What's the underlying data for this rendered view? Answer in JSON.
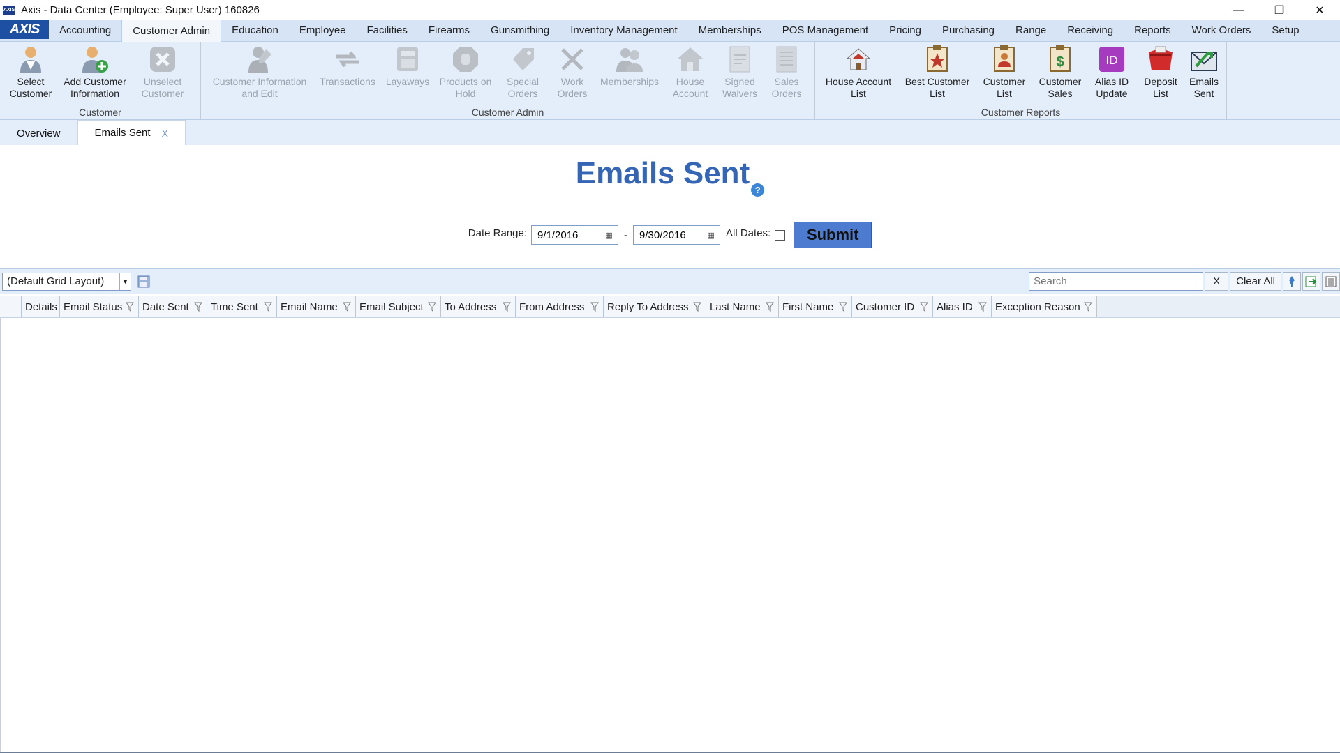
{
  "window": {
    "title": "Axis - Data Center  (Employee: Super User) 160826",
    "icon_text": "AXIS"
  },
  "menubar": {
    "logo": "AXIS",
    "tabs": [
      "Accounting",
      "Customer Admin",
      "Education",
      "Employee",
      "Facilities",
      "Firearms",
      "Gunsmithing",
      "Inventory Management",
      "Memberships",
      "POS Management",
      "Pricing",
      "Purchasing",
      "Range",
      "Receiving",
      "Reports",
      "Work Orders",
      "Setup"
    ],
    "active": "Customer Admin"
  },
  "ribbon": {
    "groups": [
      {
        "label": "Customer",
        "buttons": [
          {
            "line1": "Select",
            "line2": "Customer",
            "icon": "person-icon"
          },
          {
            "line1": "Add Customer",
            "line2": "Information",
            "icon": "add-person-icon"
          },
          {
            "line1": "Unselect",
            "line2": "Customer",
            "icon": "unselect-icon",
            "disabled": true
          }
        ]
      },
      {
        "label": "Customer Admin",
        "buttons": [
          {
            "line1": "Customer Information",
            "line2": "and Edit",
            "icon": "customer-edit-icon",
            "disabled": true
          },
          {
            "line1": "Transactions",
            "line2": "",
            "icon": "transactions-icon",
            "disabled": true
          },
          {
            "line1": "Layaways",
            "line2": "",
            "icon": "layaway-icon",
            "disabled": true
          },
          {
            "line1": "Products on",
            "line2": "Hold",
            "icon": "hold-icon",
            "disabled": true
          },
          {
            "line1": "Special",
            "line2": "Orders",
            "icon": "special-tag-icon",
            "disabled": true
          },
          {
            "line1": "Work",
            "line2": "Orders",
            "icon": "tools-icon",
            "disabled": true
          },
          {
            "line1": "Memberships",
            "line2": "",
            "icon": "members-icon",
            "disabled": true
          },
          {
            "line1": "House",
            "line2": "Account",
            "icon": "house-icon",
            "disabled": true
          },
          {
            "line1": "Signed",
            "line2": "Waivers",
            "icon": "waiver-icon",
            "disabled": true
          },
          {
            "line1": "Sales",
            "line2": "Orders",
            "icon": "sales-orders-icon",
            "disabled": true
          }
        ]
      },
      {
        "label": "Customer Reports",
        "buttons": [
          {
            "line1": "House Account",
            "line2": "List",
            "icon": "house-list-icon"
          },
          {
            "line1": "Best Customer",
            "line2": "List",
            "icon": "best-customer-icon"
          },
          {
            "line1": "Customer",
            "line2": "List",
            "icon": "customer-list-icon"
          },
          {
            "line1": "Customer",
            "line2": "Sales",
            "icon": "customer-sales-icon"
          },
          {
            "line1": "Alias ID",
            "line2": "Update",
            "icon": "alias-id-icon"
          },
          {
            "line1": "Deposit",
            "line2": "List",
            "icon": "deposit-icon"
          },
          {
            "line1": "Emails",
            "line2": "Sent",
            "icon": "emails-sent-icon"
          }
        ]
      }
    ]
  },
  "doctabs": {
    "overview": "Overview",
    "active": "Emails Sent",
    "close": "X"
  },
  "page": {
    "title": "Emails Sent",
    "help": "?",
    "date_range_label": "Date Range:",
    "date_from": "9/1/2016",
    "date_to": "9/30/2016",
    "separator": "-",
    "all_dates_label": "All Dates:",
    "submit": "Submit"
  },
  "grid": {
    "layout": "(Default Grid Layout)",
    "search_placeholder": "Search",
    "x_label": "X",
    "clear_all": "Clear All",
    "columns": [
      {
        "label": "Details",
        "filter": false
      },
      {
        "label": "Email Status",
        "filter": true
      },
      {
        "label": "Date Sent",
        "filter": true
      },
      {
        "label": "Time Sent",
        "filter": true
      },
      {
        "label": "Email Name",
        "filter": true
      },
      {
        "label": "Email Subject",
        "filter": true
      },
      {
        "label": "To Address",
        "filter": true
      },
      {
        "label": "From Address",
        "filter": true
      },
      {
        "label": "Reply To Address",
        "filter": true
      },
      {
        "label": "Last Name",
        "filter": true
      },
      {
        "label": "First Name",
        "filter": true
      },
      {
        "label": "Customer ID",
        "filter": true
      },
      {
        "label": "Alias ID",
        "filter": true
      },
      {
        "label": "Exception Reason",
        "filter": true
      }
    ]
  }
}
